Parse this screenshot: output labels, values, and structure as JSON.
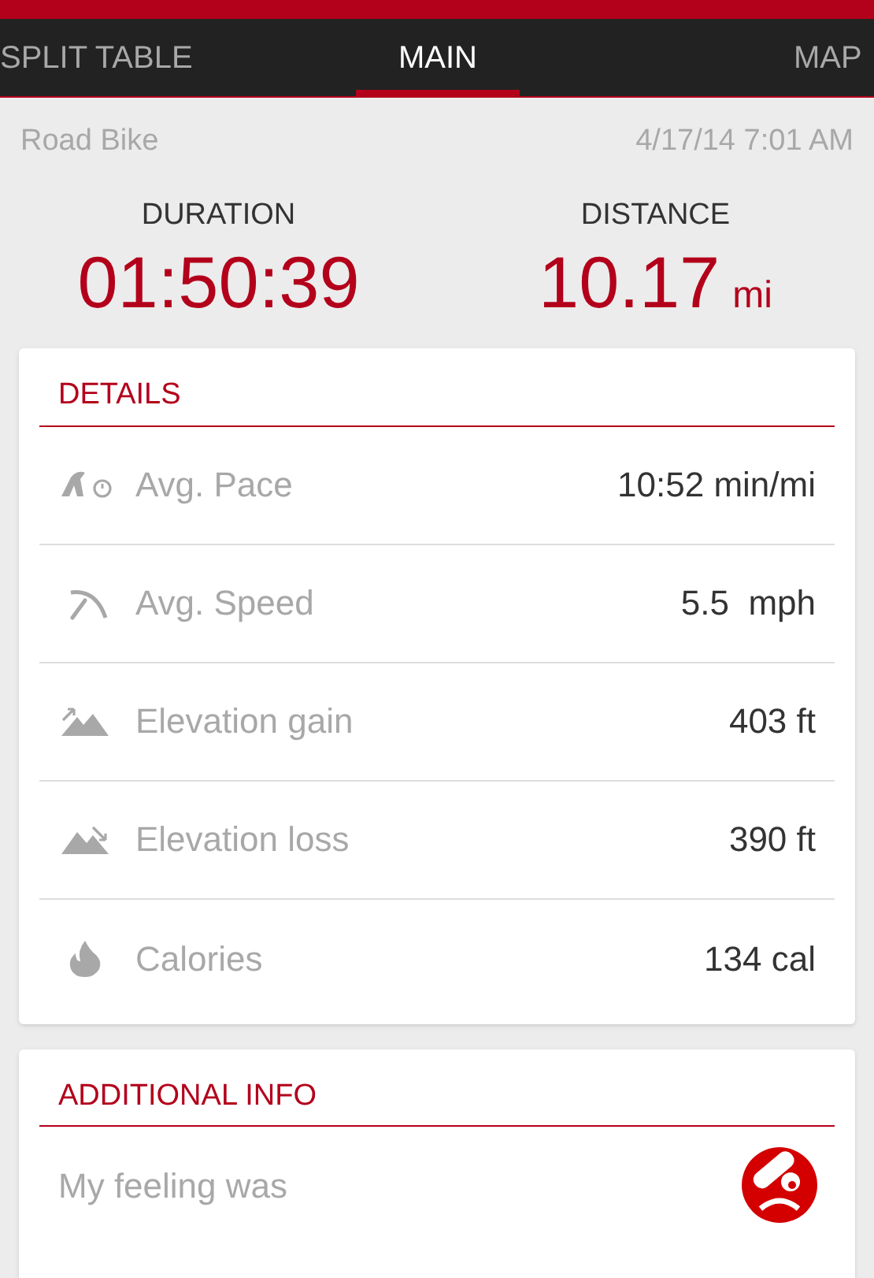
{
  "tabs": [
    {
      "label": "SPLIT TABLE",
      "selected": false
    },
    {
      "label": "MAIN",
      "selected": true
    },
    {
      "label": "MAP",
      "selected": false
    }
  ],
  "activity": {
    "type": "Road Bike",
    "datetime": "4/17/14 7:01 AM"
  },
  "summary": [
    {
      "label": "DURATION",
      "value": "01:50:39"
    },
    {
      "label": "DISTANCE",
      "value": "10.17",
      "unit": "mi"
    }
  ],
  "details": {
    "title": "DETAILS",
    "rows": [
      {
        "kind": "pace",
        "label": "Avg. Pace",
        "value": "10:52 min/mi"
      },
      {
        "kind": "speed",
        "label": "Avg. Speed",
        "value": "5.5  mph"
      },
      {
        "kind": "gain",
        "label": "Elevation gain",
        "value": "403 ft"
      },
      {
        "kind": "loss",
        "label": "Elevation loss",
        "value": "390 ft"
      },
      {
        "kind": "calories",
        "label": "Calories",
        "value": "134 cal"
      }
    ]
  },
  "additional_info": {
    "title": "ADDITIONAL INFO",
    "feeling_label": "My feeling was"
  }
}
